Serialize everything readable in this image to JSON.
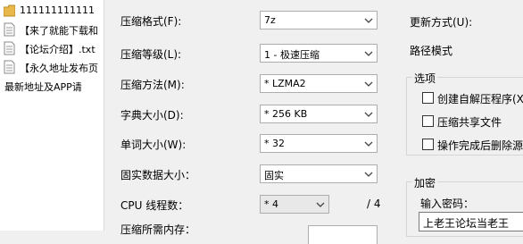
{
  "file_list": {
    "items": [
      {
        "name": "111111111111",
        "icon": "folder-icon"
      },
      {
        "name": "【来了就能下载和",
        "icon": "text-file-icon"
      },
      {
        "name": "【论坛介绍】.txt",
        "icon": "text-file-icon"
      },
      {
        "name": "【永久地址发布页",
        "icon": "text-file-icon"
      },
      {
        "name": "最新地址及APP请",
        "icon": ""
      }
    ]
  },
  "dialog": {
    "format": {
      "label": "压缩格式(F):",
      "value": "7z"
    },
    "level": {
      "label": "压缩等级(L):",
      "value": "1 - 极速压缩"
    },
    "method": {
      "label": "压缩方法(M):",
      "value": "* LZMA2"
    },
    "dict_size": {
      "label": "字典大小(D):",
      "value": "* 256 KB"
    },
    "word_size": {
      "label": "单词大小(W):",
      "value": "* 32"
    },
    "solid_block": {
      "label": "固实数据大小：",
      "value": "固实"
    },
    "cpu_threads": {
      "label": "CPU 线程数：",
      "value": "* 4",
      "max": "/ 4"
    },
    "memory": {
      "label": "压缩所需内存："
    },
    "update_mode": {
      "label": "更新方式(U):"
    },
    "path_mode": {
      "label": "路径模式"
    },
    "options": {
      "title": "选项",
      "sfx": "创建自解压程序(X)",
      "shared": "压缩共享文件",
      "delete": "操作完成后删除源文"
    },
    "encryption": {
      "title": "加密",
      "password_label": "输入密码：",
      "password_value": "上老王论坛当老王"
    }
  },
  "colors": {
    "list_bg": "#ffffff",
    "dialog_bg": "#f0f0f0"
  }
}
